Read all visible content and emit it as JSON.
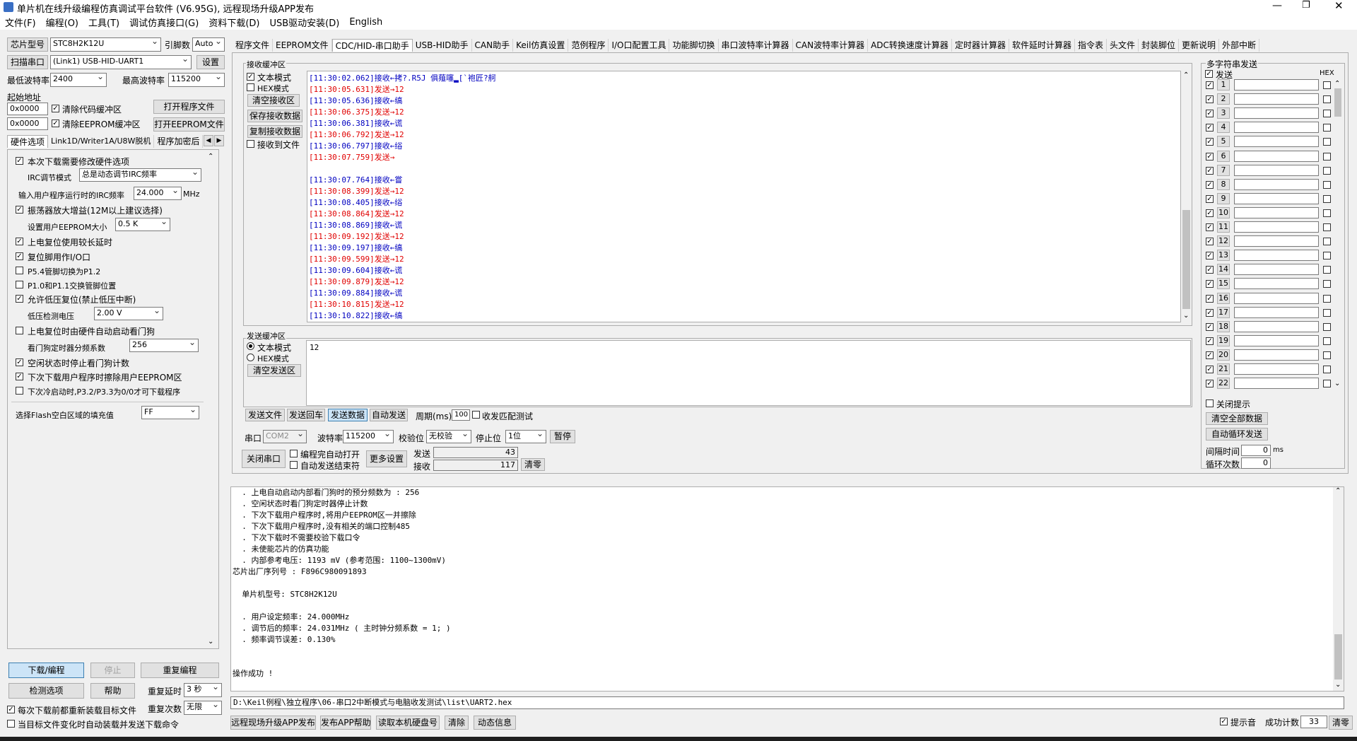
{
  "window": {
    "title": "单片机在线升级编程仿真调试平台软件 (V6.95G), 远程现场升级APP发布"
  },
  "menu": [
    "文件(F)",
    "编程(O)",
    "工具(T)",
    "调试仿真接口(G)",
    "资料下载(D)",
    "USB驱动安装(D)",
    "English"
  ],
  "left": {
    "chip_btn": "芯片型号",
    "chip_value": "STC8H2K12U",
    "pin_label": "引脚数",
    "pin_value": "Auto",
    "scan_btn": "扫描串口",
    "port_value": "(Link1) USB-HID-UART1",
    "settings_btn": "设置",
    "min_baud_label": "最低波特率",
    "min_baud_value": "2400",
    "max_baud_label": "最高波特率",
    "max_baud_value": "115200",
    "start_addr_label": "起始地址",
    "addr1": "0x0000",
    "clear_code_label": "清除代码缓冲区",
    "open_prog_btn": "打开程序文件",
    "addr2": "0x0000",
    "clear_eeprom_label": "清除EEPROM缓冲区",
    "open_eeprom_btn": "打开EEPROM文件",
    "tabs": [
      "硬件选项",
      "Link1D/Writer1A/U8W脱机",
      "程序加密后"
    ],
    "options": {
      "opt1": "本次下载需要修改硬件选项",
      "irc_mode_label": "IRC调节模式",
      "irc_mode_value": "总是动态调节IRC频率",
      "irc_freq_label": "输入用户程序运行时的IRC频率",
      "irc_freq_value": "24.000",
      "irc_unit": "MHz",
      "osc_gain": "振荡器放大增益(12M以上建议选择)",
      "eeprom_size_label": "设置用户EEPROM大小",
      "eeprom_size_value": "0.5 K",
      "long_delay": "上电复位使用较长延时",
      "reset_io": "复位脚用作I/O口",
      "p54": "P5.4管脚切换为P1.2",
      "p10": "P1.0和P1.1交换管脚位置",
      "lvr": "允许低压复位(禁止低压中断)",
      "lvd_label": "低压检测电压",
      "lvd_value": "2.00 V",
      "wdt_auto": "上电复位时由硬件自动启动看门狗",
      "wdt_div_label": "看门狗定时器分频系数",
      "wdt_div_value": "256",
      "idle_wdt": "空闲状态时停止看门狗计数",
      "erase_eeprom": "下次下载用户程序时擦除用户EEPROM区",
      "cold_boot": "下次冷启动时,P3.2/P3.3为0/0才可下载程序",
      "fill_label": "选择Flash空白区域的填充值",
      "fill_value": "FF"
    },
    "download_btn": "下载/编程",
    "stop_btn": "停止",
    "reprog_btn": "重复编程",
    "check_btn": "检测选项",
    "help_btn": "帮助",
    "retry_delay_label": "重复延时",
    "retry_delay_value": "3 秒",
    "reload_label": "每次下载前都重新装载目标文件",
    "retry_count_label": "重复次数",
    "retry_count_value": "无限",
    "auto_send_label": "当目标文件变化时自动装载并发送下载命令"
  },
  "top_tabs": [
    "程序文件",
    "EEPROM文件",
    "CDC/HID-串口助手",
    "USB-HID助手",
    "CAN助手",
    "Keil仿真设置",
    "范例程序",
    "I/O口配置工具",
    "功能脚切换",
    "串口波特率计算器",
    "CAN波特率计算器",
    "ADC转换速度计算器",
    "定时器计算器",
    "软件延时计算器",
    "指令表",
    "头文件",
    "封装脚位",
    "更新说明",
    "外部中断"
  ],
  "serial": {
    "recv_title": "接收缓冲区",
    "text_mode": "文本模式",
    "hex_mode": "HEX模式",
    "clear_recv": "清空接收区",
    "save_recv": "保存接收数据",
    "copy_recv": "复制接收数据",
    "recv_to_file": "接收到文件",
    "recv_lines": [
      {
        "t": "[11:30:02.062]",
        "d": "接收←拷?.R5J  俱薤噻▂[`袍匠?舸",
        "k": "rx"
      },
      {
        "t": "[11:30:05.631]",
        "d": "发送→12",
        "k": "tx"
      },
      {
        "t": "[11:30:05.636]",
        "d": "接收←缟",
        "k": "rx"
      },
      {
        "t": "[11:30:06.375]",
        "d": "发送→12",
        "k": "tx"
      },
      {
        "t": "[11:30:06.381]",
        "d": "接收←谎",
        "k": "rx"
      },
      {
        "t": "[11:30:06.792]",
        "d": "发送→12",
        "k": "tx"
      },
      {
        "t": "[11:30:06.797]",
        "d": "接收←绤",
        "k": "rx"
      },
      {
        "t": "[11:30:07.759]",
        "d": "发送→",
        "k": "tx"
      },
      {
        "t": "",
        "d": "",
        "k": "rx"
      },
      {
        "t": "[11:30:07.764]",
        "d": "接收←嘗",
        "k": "rx"
      },
      {
        "t": "[11:30:08.399]",
        "d": "发送→12",
        "k": "tx"
      },
      {
        "t": "[11:30:08.405]",
        "d": "接收←绤",
        "k": "rx"
      },
      {
        "t": "[11:30:08.864]",
        "d": "发送→12",
        "k": "tx"
      },
      {
        "t": "[11:30:08.869]",
        "d": "接收←谎",
        "k": "rx"
      },
      {
        "t": "[11:30:09.192]",
        "d": "发送→12",
        "k": "tx"
      },
      {
        "t": "[11:30:09.197]",
        "d": "接收←缟",
        "k": "rx"
      },
      {
        "t": "[11:30:09.599]",
        "d": "发送→12",
        "k": "tx"
      },
      {
        "t": "[11:30:09.604]",
        "d": "接收←谎",
        "k": "rx"
      },
      {
        "t": "[11:30:09.879]",
        "d": "发送→12",
        "k": "tx"
      },
      {
        "t": "[11:30:09.884]",
        "d": "接收←谎",
        "k": "rx"
      },
      {
        "t": "[11:30:10.815]",
        "d": "发送→12",
        "k": "tx"
      },
      {
        "t": "[11:30:10.822]",
        "d": "接收←缟",
        "k": "rx"
      }
    ],
    "send_title": "发送缓冲区",
    "send_text_mode": "文本模式",
    "send_hex_mode": "HEX模式",
    "clear_send": "清空发送区",
    "send_value": "12",
    "send_file_btn": "发送文件",
    "send_enter_btn": "发送回车",
    "send_data_btn": "发送数据",
    "auto_send_btn": "自动发送",
    "period_label": "周期(ms)",
    "period_value": "100",
    "match_test": "收发匹配测试",
    "port_label": "串口",
    "port_value": "COM2",
    "baud_label": "波特率",
    "baud_value": "115200",
    "parity_label": "校验位",
    "parity_value": "无校验",
    "stop_label": "停止位",
    "stop_value": "1位",
    "pause_btn": "暂停",
    "close_port_btn": "关闭串口",
    "auto_open": "编程完自动打开",
    "auto_send_end": "自动发送结束符",
    "more_settings": "更多设置",
    "send_count_label": "发送",
    "send_count": "43",
    "recv_count_label": "接收",
    "recv_count": "117",
    "clear_count_btn": "清零"
  },
  "multi": {
    "title": "多字符串发送",
    "send_label": "发送",
    "hex_label": "HEX",
    "rows": [
      "1",
      "2",
      "3",
      "4",
      "5",
      "6",
      "7",
      "8",
      "9",
      "10",
      "11",
      "12",
      "13",
      "14",
      "15",
      "16",
      "17",
      "18",
      "19",
      "20",
      "21",
      "22"
    ],
    "close_tip": "关闭提示",
    "clear_all": "清空全部数据",
    "auto_cycle": "自动循环发送",
    "interval_label": "间隔时间",
    "interval_value": "0",
    "interval_unit": "ms",
    "cycle_label": "循环次数",
    "cycle_value": "0"
  },
  "log": [
    "  . 上电自动启动内部看门狗时的预分频数为 : 256",
    "  . 空闲状态时看门狗定时器停止计数",
    "  . 下次下载用户程序时,将用户EEPROM区一并擦除",
    "  . 下次下载用户程序时,没有相关的端口控制485",
    "  . 下次下载时不需要校验下载口令",
    "  . 未使能芯片的仿真功能",
    "  . 内部参考电压: 1193 mV (参考范围: 1100~1300mV)",
    "芯片出厂序列号 : F896C980091893",
    "",
    "  单片机型号: STC8H2K12U",
    "",
    "  . 用户设定频率: 24.000MHz",
    "  . 调节后的频率: 24.031MHz ( 主时钟分频系数 = 1; )",
    "  . 频率调节误差: 0.130%",
    "",
    "",
    "操作成功 !"
  ],
  "bottom": {
    "path": "D:\\Keil例程\\独立程序\\06-串口2中断模式与电脑收发测试\\list\\UART2.hex",
    "publish_btn": "远程现场升级APP发布",
    "publish_help_btn": "发布APP帮助",
    "disk_btn": "读取本机硬盘号",
    "clear_btn": "清除",
    "dynamic_btn": "动态信息",
    "beep_label": "提示音",
    "success_label": "成功计数",
    "success_value": "33",
    "reset_btn": "清零"
  }
}
